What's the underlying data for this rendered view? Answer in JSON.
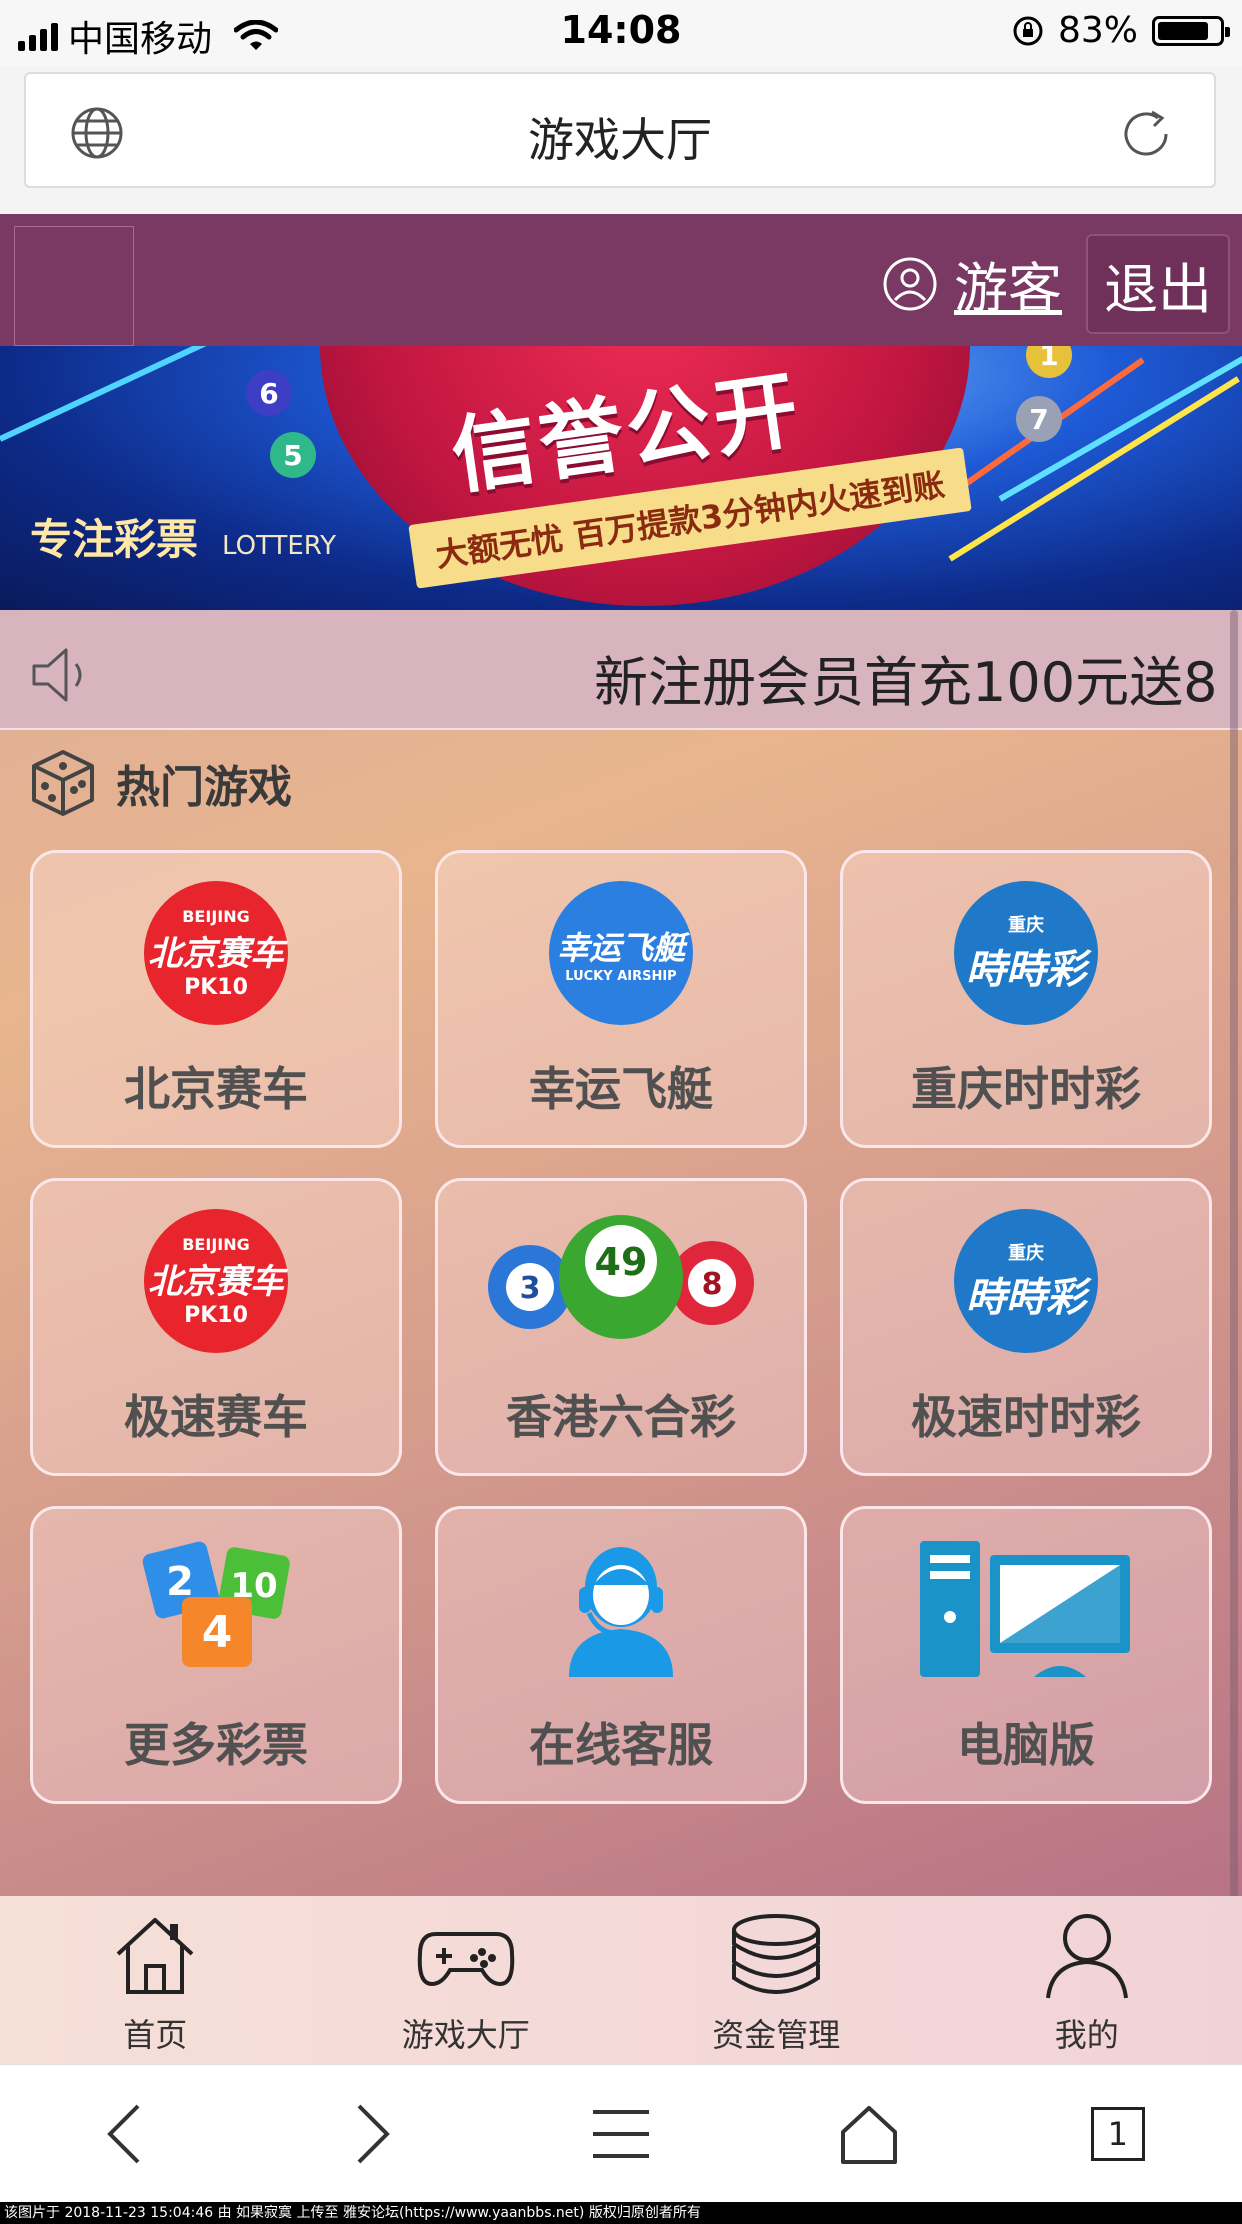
{
  "status_bar": {
    "carrier": "中国移动",
    "time": "14:08",
    "battery_percent_text": "83%",
    "battery_level": 0.83
  },
  "browser": {
    "page_title": "游戏大厅",
    "tab_count": "1"
  },
  "header": {
    "username": "游客",
    "logout_label": "退出"
  },
  "banner": {
    "headline": "信誉公开",
    "ribbon": "大额无忧 百万提款3分钟内火速到账",
    "slogan": "专注彩票",
    "slogan_en": "LOTTERY",
    "balls": [
      "6",
      "5",
      "7",
      "1"
    ]
  },
  "notice": {
    "text": "新注册会员首充100元送8"
  },
  "hot_games": {
    "title": "热门游戏",
    "items": [
      {
        "label": "北京赛车",
        "logo_top": "BEIJING",
        "logo_main": "北京赛车",
        "logo_sub": "PK10"
      },
      {
        "label": "幸运飞艇",
        "logo_main": "幸运飞艇",
        "logo_sub": "LUCKY AIRSHIP"
      },
      {
        "label": "重庆时时彩",
        "logo_top": "重庆",
        "logo_main": "時時彩"
      },
      {
        "label": "极速赛车",
        "logo_top": "BEIJING",
        "logo_main": "北京赛车",
        "logo_sub": "PK10"
      },
      {
        "label": "香港六合彩",
        "balls": [
          "3",
          "49",
          "8"
        ]
      },
      {
        "label": "极速时时彩",
        "logo_top": "重庆",
        "logo_main": "時時彩"
      },
      {
        "label": "更多彩票",
        "tiles": [
          "2",
          "10",
          "4"
        ]
      },
      {
        "label": "在线客服"
      },
      {
        "label": "电脑版"
      }
    ]
  },
  "bottom_nav": {
    "items": [
      {
        "label": "首页"
      },
      {
        "label": "游戏大厅"
      },
      {
        "label": "资金管理"
      },
      {
        "label": "我的"
      }
    ]
  },
  "footer_note": "该图片于 2018-11-23 15:04:46 由 如果寂寞 上传至 雅安论坛(https://www.yaanbbs.net) 版权归原创者所有",
  "colors": {
    "header_bg": "#7a3963",
    "pk10_red": "#e8242c",
    "blue_logo": "#1f78c8",
    "accent_yellow": "#ffe100"
  }
}
